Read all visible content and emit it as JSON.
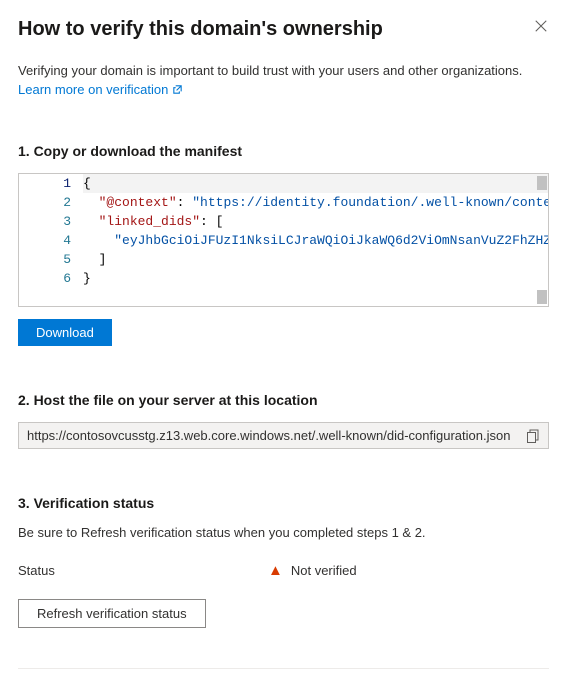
{
  "header": {
    "title": "How to verify this domain's ownership"
  },
  "intro": {
    "text": "Verifying your domain is important to build trust with your users and other organizations.",
    "link_label": "Learn more on verification"
  },
  "section1": {
    "title": "1. Copy or download the manifest",
    "code_lines": [
      {
        "n": "1",
        "indent": "",
        "segments": [
          {
            "cls": "tok-brace",
            "t": "{"
          }
        ]
      },
      {
        "n": "2",
        "indent": "  ",
        "segments": [
          {
            "cls": "tok-key",
            "t": "\"@context\""
          },
          {
            "cls": "tok-punc",
            "t": ": "
          },
          {
            "cls": "tok-str",
            "t": "\"https://identity.foundation/.well-known/conte"
          }
        ]
      },
      {
        "n": "3",
        "indent": "  ",
        "segments": [
          {
            "cls": "tok-key",
            "t": "\"linked_dids\""
          },
          {
            "cls": "tok-punc",
            "t": ": ["
          }
        ]
      },
      {
        "n": "4",
        "indent": "    ",
        "segments": [
          {
            "cls": "tok-str",
            "t": "\"eyJhbGciOiJFUzI1NksiLCJraWQiOiJkaWQ6d2ViOmNsanVuZ2FhZHZ"
          }
        ]
      },
      {
        "n": "5",
        "indent": "  ",
        "segments": [
          {
            "cls": "tok-punc",
            "t": "]"
          }
        ]
      },
      {
        "n": "6",
        "indent": "",
        "segments": [
          {
            "cls": "tok-brace",
            "t": "}"
          }
        ]
      }
    ],
    "download_label": "Download"
  },
  "section2": {
    "title": "2. Host the file on your server at this location",
    "url": "https://contosovcusstg.z13.web.core.windows.net/.well-known/did-configuration.json"
  },
  "section3": {
    "title": "3. Verification status",
    "help": "Be sure to Refresh verification status when you completed steps 1 & 2.",
    "status_label": "Status",
    "status_value": "Not verified",
    "refresh_label": "Refresh verification status"
  }
}
